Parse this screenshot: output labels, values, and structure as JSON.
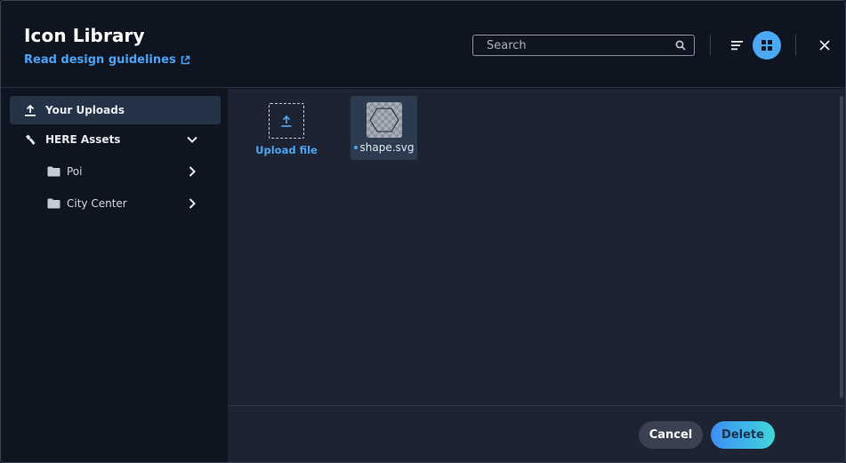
{
  "header": {
    "title": "Icon Library",
    "guidelines_link": "Read design guidelines",
    "search_placeholder": "Search"
  },
  "sidebar": {
    "items": [
      {
        "label": "Your Uploads",
        "icon": "upload-icon",
        "active": true
      },
      {
        "label": "HERE Assets",
        "icon": "satellite-icon",
        "expanded": true
      },
      {
        "label": "Poi",
        "icon": "folder-icon"
      },
      {
        "label": "City Center",
        "icon": "folder-icon"
      }
    ]
  },
  "main": {
    "upload_label": "Upload file",
    "files": [
      {
        "name": "shape.svg",
        "selected": true
      }
    ]
  },
  "footer": {
    "cancel_label": "Cancel",
    "delete_label": "Delete"
  },
  "colors": {
    "accent": "#48a5f5",
    "dialog_bg": "#0f1520",
    "content_bg": "#1d2330",
    "selected_bg": "#253347"
  }
}
